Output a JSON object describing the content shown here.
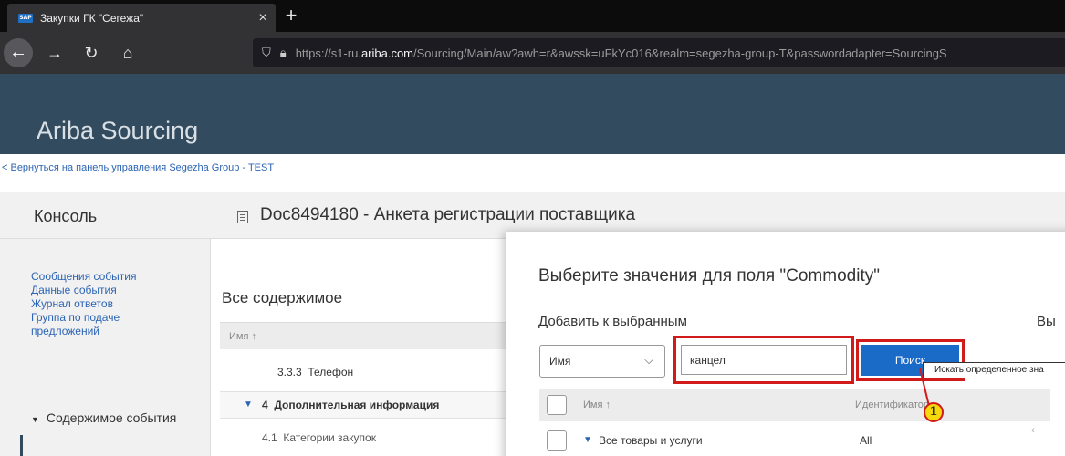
{
  "browser": {
    "tab_title": "Закупки ГК \"Сегежа\"",
    "tab_close": "×",
    "new_tab": "+",
    "url_prefix": "https://s1-ru.",
    "url_domain": "ariba.com",
    "url_rest": "/Sourcing/Main/aw?awh=r&awssk=uFkYc016&realm=segezha-group-T&passwordadapter=SourcingS"
  },
  "header": {
    "app_title": "Ariba Sourcing"
  },
  "backlink": "< Вернуться на панель управления Segezha Group - TEST",
  "console": {
    "title": "Консоль",
    "doc_title": "Doc8494180 - Анкета регистрации поставщика"
  },
  "leftnav": {
    "links": [
      "Сообщения события",
      "Данные события",
      "Журнал ответов",
      "Группа по подаче",
      "предложений"
    ],
    "section": "Содержимое события"
  },
  "main": {
    "heading": "Все содержимое",
    "col_name": "Имя ↑",
    "rows": [
      {
        "num": "3.3.3",
        "label": "Телефон"
      },
      {
        "num": "4",
        "label": "Дополнительная информация"
      },
      {
        "num": "4.1",
        "label": "Категории закупок"
      }
    ]
  },
  "dialog": {
    "title": "Выберите значения для поля \"Commodity\"",
    "add_label": "Добавить к выбранным",
    "right_label": "Вы",
    "select_value": "Имя",
    "search_value": "канцел",
    "search_button": "Поиск",
    "tooltip": "Искать определенное зна",
    "col_name": "Имя ↑",
    "col_id": "Идентификатор",
    "row_name": "Все товары и услуги",
    "row_id": "All"
  },
  "marker": {
    "number": "1",
    "color": "#d11a1a"
  },
  "colors": {
    "accent": "#1a6ac8",
    "header": "#334b5e",
    "link": "#2c64b4"
  }
}
